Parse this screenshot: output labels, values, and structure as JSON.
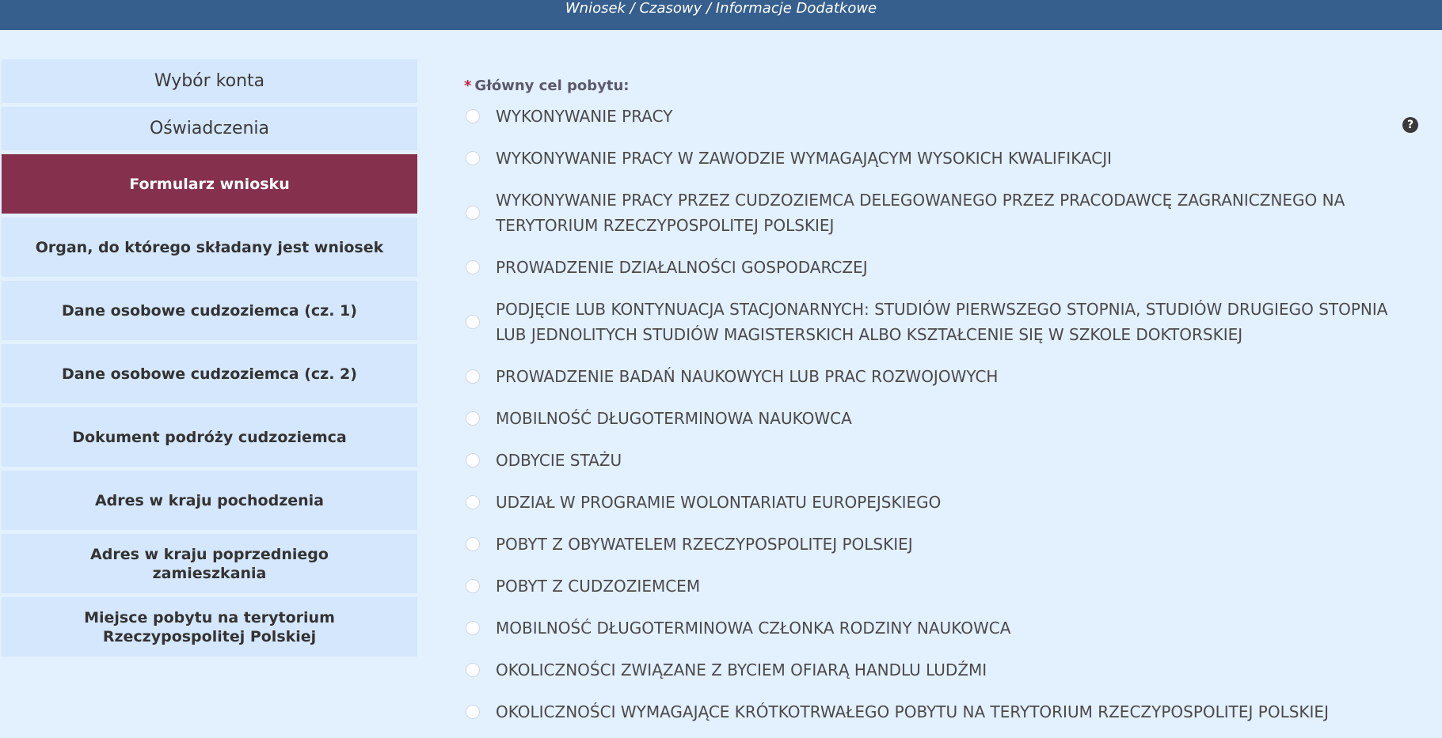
{
  "header": {
    "breadcrumb": "Wniosek / Czasowy / Informacje Dodatkowe"
  },
  "sidebar": {
    "top_items": [
      {
        "label": "Wybór konta"
      },
      {
        "label": "Oświadczenia"
      }
    ],
    "steps": [
      {
        "label": "Formularz wniosku",
        "active": true
      },
      {
        "label": "Organ, do którego składany jest wniosek"
      },
      {
        "label": "Dane osobowe cudzoziemca (cz. 1)"
      },
      {
        "label": "Dane osobowe cudzoziemca (cz. 2)"
      },
      {
        "label": "Dokument podróży cudzoziemca"
      },
      {
        "label": "Adres w kraju pochodzenia"
      },
      {
        "label": "Adres w kraju poprzedniego zamieszkania"
      },
      {
        "label": "Miejsce pobytu na terytorium Rzeczypospolitej Polskiej"
      }
    ]
  },
  "form": {
    "required_mark": "*",
    "purpose_label": "Główny cel pobytu:",
    "help_icon": "?",
    "options": [
      "WYKONYWANIE PRACY",
      "WYKONYWANIE PRACY W ZAWODZIE WYMAGAJĄCYM WYSOKICH KWALIFIKACJI",
      "WYKONYWANIE PRACY PRZEZ CUDZOZIEMCA DELEGOWANEGO PRZEZ PRACODAWCĘ ZAGRANICZNEGO NA TERYTORIUM RZECZYPOSPOLITEJ POLSKIEJ",
      "PROWADZENIE DZIAŁALNOŚCI GOSPODARCZEJ",
      "PODJĘCIE LUB KONTYNUACJA STACJONARNYCH: STUDIÓW PIERWSZEGO STOPNIA, STUDIÓW DRUGIEGO STOPNIA LUB JEDNOLITYCH STUDIÓW MAGISTERSKICH ALBO KSZTAŁCENIE SIĘ W SZKOLE DOKTORSKIEJ",
      "PROWADZENIE BADAŃ NAUKOWYCH LUB PRAC ROZWOJOWYCH",
      "MOBILNOŚĆ DŁUGOTERMINOWA NAUKOWCA",
      "ODBYCIE STAŻU",
      "UDZIAŁ W PROGRAMIE WOLONTARIATU EUROPEJSKIEGO",
      "POBYT Z OBYWATELEM RZECZYPOSPOLITEJ POLSKIEJ",
      "POBYT Z CUDZOZIEMCEM",
      "MOBILNOŚĆ DŁUGOTERMINOWA CZŁONKA RODZINY NAUKOWCA",
      "OKOLICZNOŚCI ZWIĄZANE Z BYCIEM OFIARĄ HANDLU LUDŹMI",
      "OKOLICZNOŚCI WYMAGAJĄCE KRÓTKOTRWAŁEGO POBYTU NA TERYTORIUM RZECZYPOSPOLITEJ POLSKIEJ"
    ]
  },
  "colors": {
    "header_bg": "#365f8e",
    "page_bg": "#e3f0fe",
    "sidebar_item_bg": "#d5e7fc",
    "active_step_bg": "#85304c",
    "required_mark": "#c0213a"
  }
}
